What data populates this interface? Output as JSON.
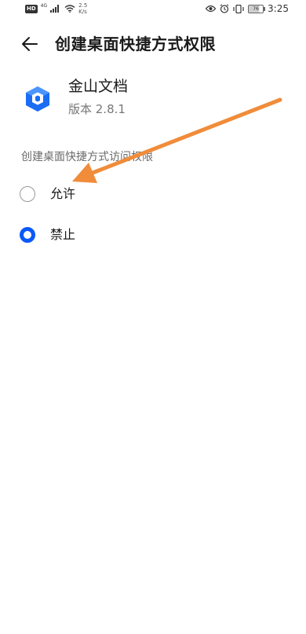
{
  "status_bar": {
    "hd": "HD",
    "network": "4G",
    "speed_value": "2.5",
    "speed_unit": "K/s",
    "battery": "76",
    "time": "3:25"
  },
  "header": {
    "title": "创建桌面快捷方式权限"
  },
  "app": {
    "name": "金山文档",
    "version": "版本 2.8.1",
    "icon_color": "#1a6cf3"
  },
  "section": {
    "header": "创建桌面快捷方式访问权限"
  },
  "options": [
    {
      "label": "允许",
      "selected": false
    },
    {
      "label": "禁止",
      "selected": true
    }
  ],
  "colors": {
    "accent": "#0a59f7",
    "annotation_arrow": "#f08c3a"
  }
}
